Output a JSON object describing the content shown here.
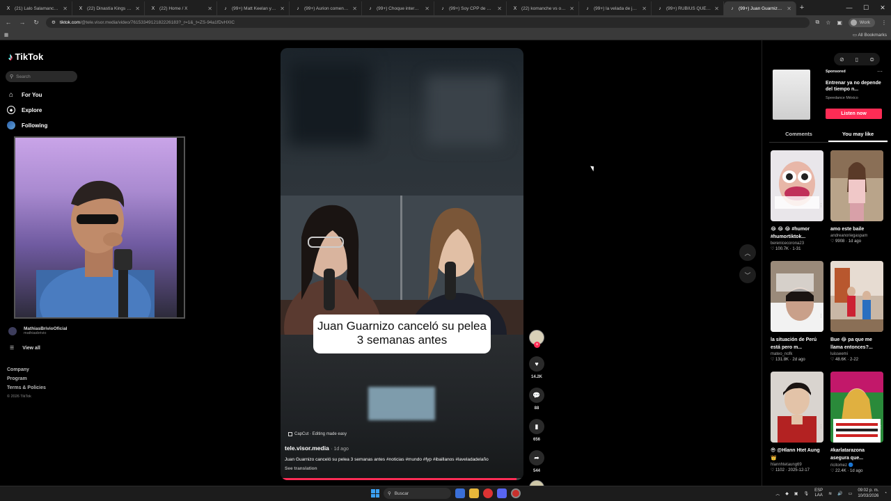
{
  "browser": {
    "tabs": [
      {
        "icon": "X",
        "title": "(21) Lalo Salamanca on X:",
        "active": false
      },
      {
        "icon": "X",
        "title": "(22) Dinastía Kings 👑 al",
        "active": false
      },
      {
        "icon": "X",
        "title": "(22) Home / X",
        "active": false
      },
      {
        "icon": "♪",
        "title": "(99+) Matt Keelan y su he",
        "active": false
      },
      {
        "icon": "♪",
        "title": "(99+) Aurion comenta que",
        "active": false
      },
      {
        "icon": "♪",
        "title": "(99+) Choque internacio",
        "active": false
      },
      {
        "icon": "♪",
        "title": "(99+) Soy CPP de papito",
        "active": false
      },
      {
        "icon": "X",
        "title": "(22) komanche vs on X: \"",
        "active": false
      },
      {
        "icon": "♪",
        "title": "(99+) la velada de juan 4",
        "active": false
      },
      {
        "icon": "♪",
        "title": "(99+) RUBIUS QUEDÓ ID",
        "active": false
      },
      {
        "icon": "♪",
        "title": "(99+) Juan Guarnizo c",
        "active": true
      }
    ],
    "url_host": "tiktok.com",
    "url_path": "/@tele.visor.media/video/7615334912182226183?_r=1&_t=ZS-94a1fDvHXIC",
    "profile_label": "Work",
    "bookmarks_label": "All Bookmarks"
  },
  "sidebar": {
    "brand": "TikTok",
    "search_placeholder": "Search",
    "nav": [
      {
        "label": "For You",
        "icon": "home-icon"
      },
      {
        "label": "Explore",
        "icon": "compass-icon"
      },
      {
        "label": "Following",
        "icon": "following-icon"
      }
    ],
    "following_account": {
      "name": "MathiasBrivioOficial",
      "handle": "mathiasbrivio"
    },
    "view_all": "View all",
    "footer": [
      "Company",
      "Program",
      "Terms & Policies"
    ],
    "copyright": "© 2026 TikTok"
  },
  "video": {
    "caption_overlay": "Juan Guarnizo canceló su pelea 3 semanas antes",
    "capcut_label": "CapCut · Editing made easy",
    "author": "tele.visor.media",
    "age": "· 1d ago",
    "description": "Juan Guarnizo canceló su pelea 3 semanas antes #noticias #mundo #fyp #ibaillanos #laveladadelaño",
    "see_translation": "See translation",
    "progress": 0.97
  },
  "actions": {
    "likes": "14.2K",
    "comments": "88",
    "saves": "656",
    "shares": "544"
  },
  "right_panel": {
    "sponsored_label": "Sponsored",
    "ad_title": "Entrenar ya no depende del tiempo n...",
    "ad_brand": "Speedance México",
    "ad_cta": "Listen now",
    "tab_comments": "Comments",
    "tab_you_may_like": "You may like",
    "cards": [
      {
        "title": "😂 😂 😂 #humor #humortiktok...",
        "author": "berenicecorona23",
        "stats": "♡ 100.7K · 1-31"
      },
      {
        "title": "amo este baile",
        "author": "andreanoriegaspam",
        "stats": "♡ 9908 · 1d ago"
      },
      {
        "title": "la situación de Perú está pero m...",
        "author": "mateo_nofk",
        "stats": "♡ 131.8K · 2d ago"
      },
      {
        "title": "Bue 😂 pa que me llama entonces?...",
        "author": "luisseemi",
        "stats": "♡ 48.6K · 2-22"
      },
      {
        "title": "😎 @Hlann Htet Aung 👑",
        "author": "hlannhtetaung69",
        "stats": "♡ 1102 · 2025-12-17"
      },
      {
        "title": "#karlatarazona asegura que...",
        "author": "ricitomez 🔵",
        "stats": "♡ 22.4K · 1d ago"
      }
    ]
  },
  "taskbar": {
    "search_label": "Buscar",
    "lang_top": "ESP",
    "lang_bottom": "LAA",
    "time": "09:02 p. m.",
    "date": "10/03/2026"
  }
}
